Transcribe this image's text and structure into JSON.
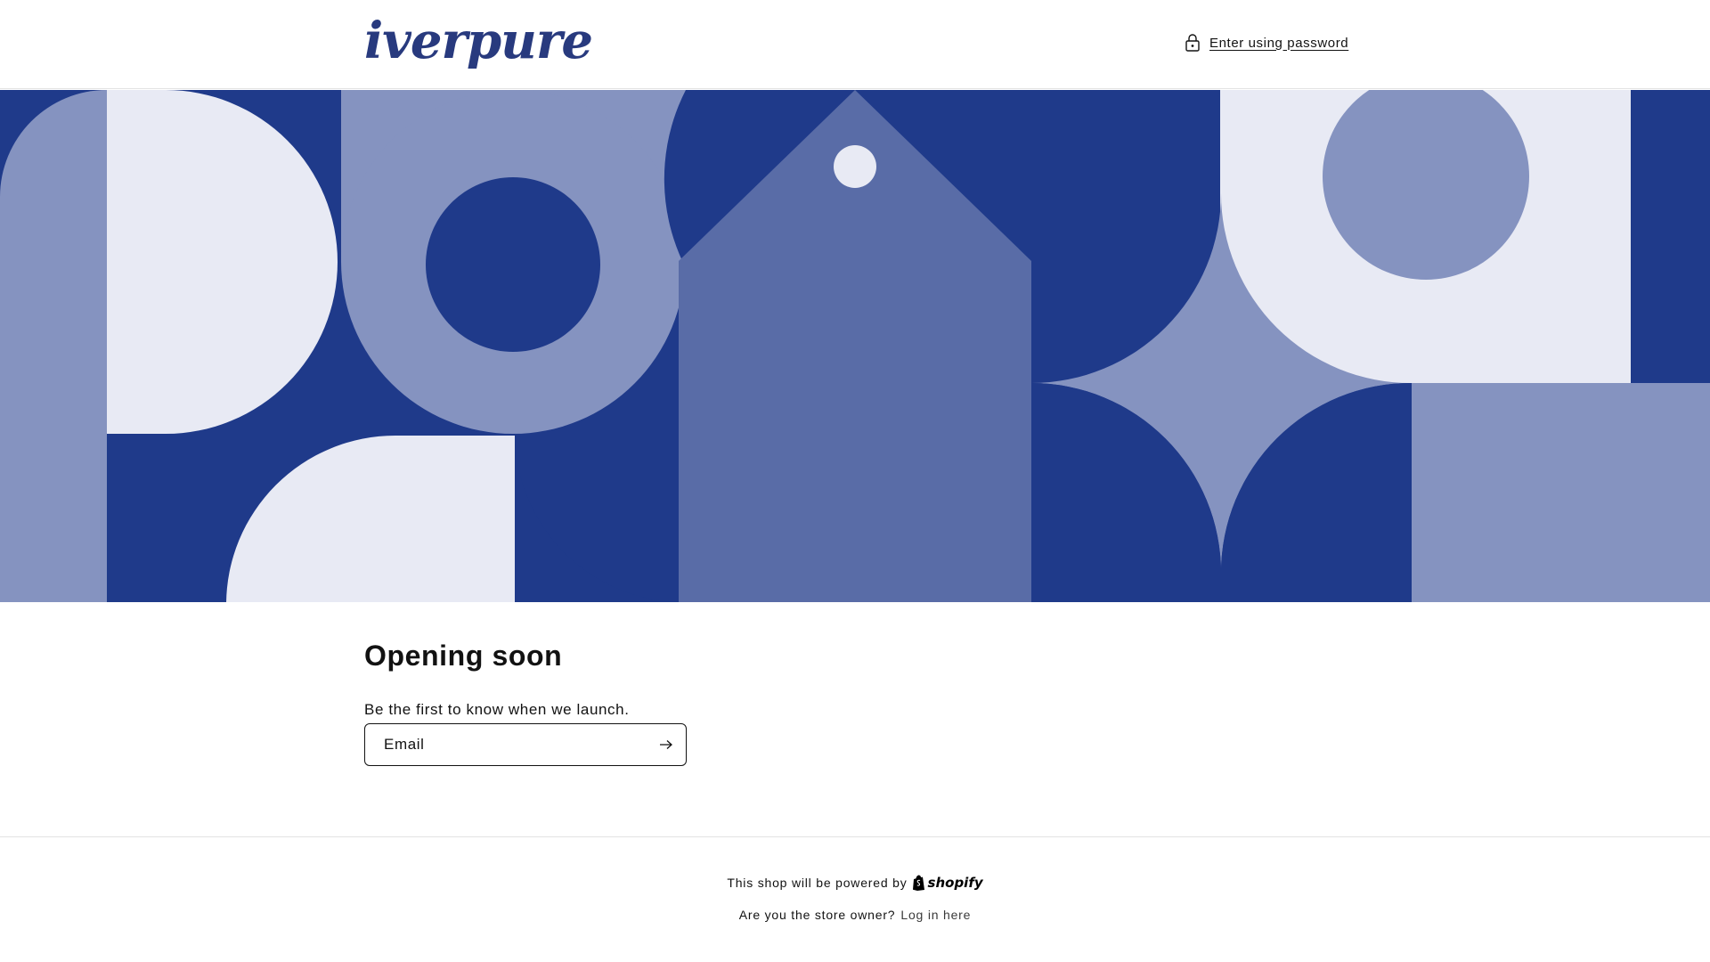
{
  "header": {
    "logo_text": "iverpure",
    "password_link": "Enter using password",
    "lock_icon": "lock-icon"
  },
  "main": {
    "title": "Opening soon",
    "lead": "Be the first to know when we launch.",
    "email_placeholder": "Email",
    "submit_icon": "arrow-right-icon"
  },
  "footer": {
    "powered_text": "This shop will be powered by",
    "shopify_logo_text": "shopify",
    "owner_question": "Are you the store owner?",
    "login_link": "Log in here"
  },
  "colors": {
    "brand_navy": "#1f3a8a",
    "brand_periwinkle": "#8593c0",
    "brand_mid": "#596ca7",
    "brand_pale": "#e8eaf4",
    "logo": "#283a7e"
  }
}
